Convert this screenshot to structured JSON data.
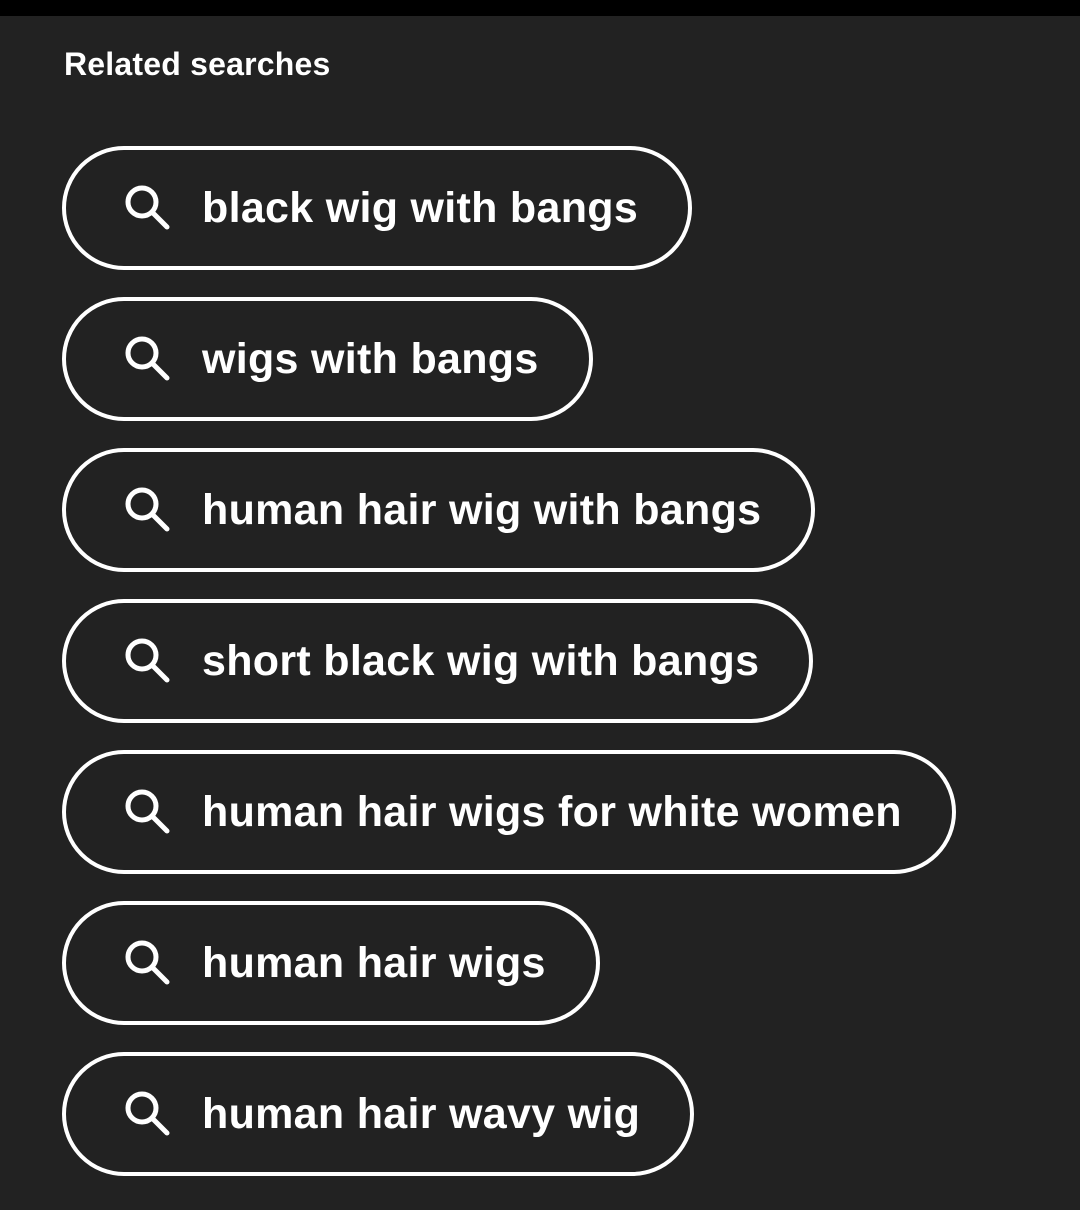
{
  "section": {
    "heading": "Related searches"
  },
  "searches": [
    {
      "label": "black wig with bangs",
      "icon": "search-icon"
    },
    {
      "label": "wigs with bangs",
      "icon": "search-icon"
    },
    {
      "label": "human hair wig with bangs",
      "icon": "search-icon"
    },
    {
      "label": "short black wig with bangs",
      "icon": "search-icon"
    },
    {
      "label": "human hair wigs for white women",
      "icon": "search-icon"
    },
    {
      "label": "human hair wigs",
      "icon": "search-icon"
    },
    {
      "label": "human hair wavy wig",
      "icon": "search-icon"
    }
  ],
  "colors": {
    "background": "#222222",
    "top_bar": "#000000",
    "text": "#ffffff",
    "pill_border": "#ffffff"
  }
}
